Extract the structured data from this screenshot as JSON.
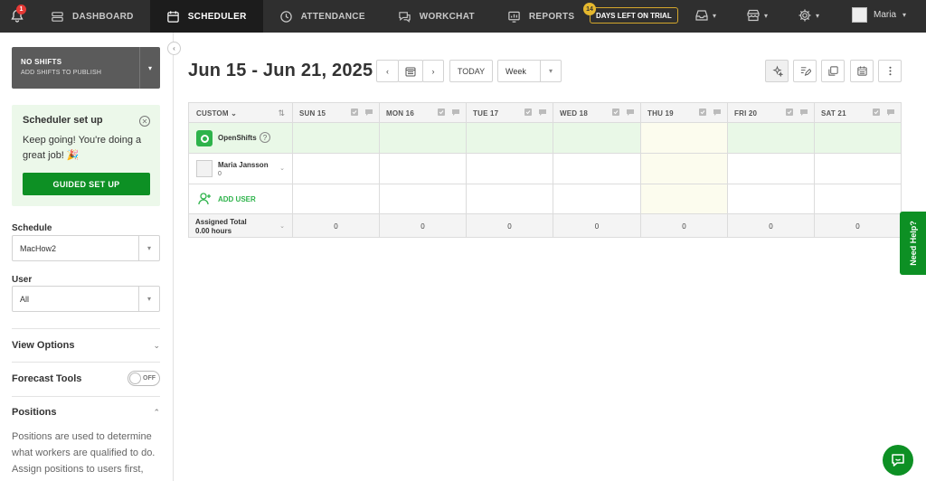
{
  "nav": {
    "notification_count": "1",
    "items": [
      {
        "label": "DASHBOARD",
        "icon": "dashboard-icon"
      },
      {
        "label": "SCHEDULER",
        "icon": "calendar-icon"
      },
      {
        "label": "ATTENDANCE",
        "icon": "clock-icon"
      },
      {
        "label": "WORKCHAT",
        "icon": "chat-icon"
      },
      {
        "label": "REPORTS",
        "icon": "reports-icon"
      }
    ],
    "trial_days": "14",
    "trial_label": "DAYS LEFT ON TRIAL",
    "user_name": "Maria"
  },
  "sidebar": {
    "publish_title": "NO SHIFTS",
    "publish_subtitle": "ADD SHIFTS TO PUBLISH",
    "setup_title": "Scheduler set up",
    "setup_text": "Keep going! You're doing a great job! 🎉",
    "setup_button": "GUIDED SET UP",
    "schedule_label": "Schedule",
    "schedule_value": "MacHow2",
    "user_label": "User",
    "user_value": "All",
    "view_options": "View Options",
    "forecast_tools": "Forecast Tools",
    "forecast_toggle": "OFF",
    "positions": "Positions",
    "positions_desc": "Positions are used to determine what workers are qualified to do. Assign positions to users first,"
  },
  "main": {
    "date_range": "Jun 15 - Jun 21, 2025",
    "today": "TODAY",
    "view": "Week"
  },
  "grid": {
    "sort_label": "CUSTOM",
    "days": [
      "SUN 15",
      "MON 16",
      "TUE 17",
      "WED 18",
      "THU 19",
      "FRI 20",
      "SAT 21"
    ],
    "open_shifts": "OpenShifts",
    "user_name": "Maria Jansson",
    "user_hours": "0",
    "add_user": "ADD USER",
    "total_label": "Assigned Total",
    "total_hours": "0.00 hours",
    "totals": [
      "0",
      "0",
      "0",
      "0",
      "0",
      "0",
      "0"
    ]
  },
  "help_tab": "Need Help?"
}
